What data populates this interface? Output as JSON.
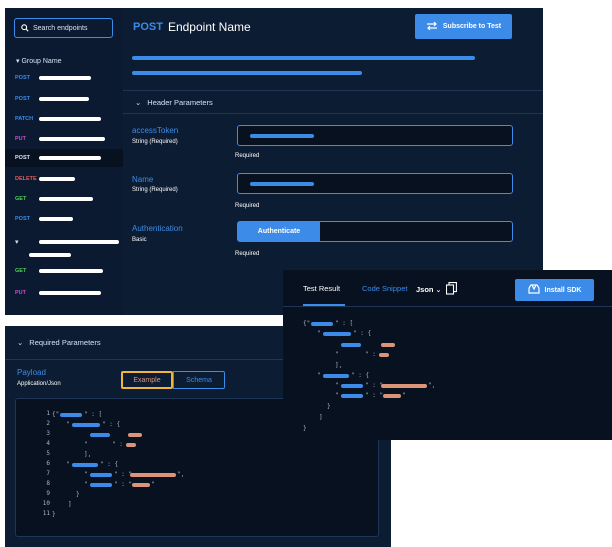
{
  "search": {
    "placeholder": "Search endpoints"
  },
  "sidebar": {
    "group_name": "Group Name",
    "items": [
      {
        "method": "POST"
      },
      {
        "method": "POST"
      },
      {
        "method": "PATCH"
      },
      {
        "method": "PUT"
      },
      {
        "method": "POST"
      },
      {
        "method": "DELETE"
      },
      {
        "method": "GET"
      },
      {
        "method": "POST"
      },
      {
        "method": "GET"
      },
      {
        "method": "PUT"
      }
    ]
  },
  "header": {
    "method": "POST",
    "title": "Endpoint Name",
    "subscribe_label": "Subscribe to Test"
  },
  "header_params": {
    "section_title": "Header Parameters",
    "params": [
      {
        "name": "accessToken",
        "type": "String (Required)",
        "required": "Required"
      },
      {
        "name": "Name",
        "type": "String (Required)",
        "required": "Required"
      },
      {
        "name": "Authentication",
        "type": "Basic",
        "required": "Required",
        "button": "Authenticate"
      }
    ]
  },
  "required_params": {
    "section_title": "Required Parameters",
    "payload_label": "Payload",
    "payload_type": "Application/Json",
    "toggle": [
      "Example",
      "Schema"
    ],
    "line_numbers": [
      "1",
      "2",
      "3",
      "4",
      "5",
      "6",
      "7",
      "8",
      "9",
      "10",
      "11"
    ]
  },
  "test_result": {
    "tabs": [
      "Test Result",
      "Code Snippet"
    ],
    "format": "Json",
    "install_label": "Install SDK"
  },
  "colors": {
    "background": "#0c1c33",
    "accent": "#3d8be8",
    "post": "#3d8be8",
    "patch": "#3d8be8",
    "put": "#c14fd1",
    "delete": "#e65a5a",
    "get": "#4fd15a",
    "value": "#dc9478",
    "highlight": "#f0b43c"
  }
}
